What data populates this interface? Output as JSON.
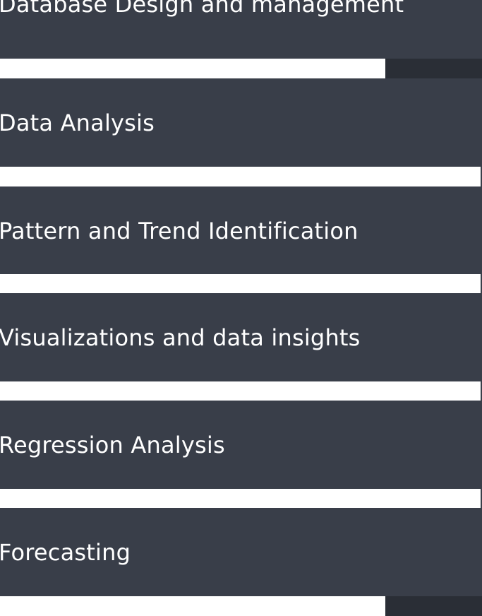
{
  "skills": {
    "items": [
      {
        "label": "Database Design and management"
      },
      {
        "label": "Data Analysis"
      },
      {
        "label": "Pattern and Trend Identification"
      },
      {
        "label": "Visualizations and data insights"
      },
      {
        "label": "Regression Analysis"
      },
      {
        "label": "Forecasting"
      }
    ]
  },
  "colors": {
    "card_background": "#393e49",
    "strip_background": "#ffffff",
    "progress_fill": "#2a2e36",
    "text": "#ffffff"
  }
}
